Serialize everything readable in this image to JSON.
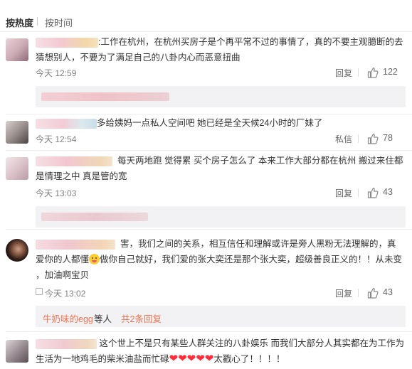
{
  "sort": {
    "hot_label": "按热度",
    "time_label": "按时间"
  },
  "colors": {
    "accent": "#eb7350",
    "heart": "#ff2d3a"
  },
  "comments": [
    {
      "text_line1": "工作在杭州，在杭州买房子是个再平常不过的事情了，真的不要主观臆断的去",
      "text_line2": "猜想别人，不要为了满足自己的八卦内心而恶意扭曲",
      "time": "今天 12:59",
      "reply_label": "回复",
      "likes": "122"
    },
    {
      "text_line1": "多给姨妈一点私人空间吧 她已经是全天候24小时的厂妹了",
      "time": "今天 12:54",
      "reply_label": "私信",
      "likes": "78"
    },
    {
      "text_line1": "每天两地跑 觉得累 买个房子怎么了 本来工作大部分都在杭州 搬过来住都",
      "text_line2": "是情理之中 真是管的宽",
      "time": "今天 13:03",
      "reply_label": "回复",
      "likes": "43"
    },
    {
      "text_line1": "害，我们之间的关系，相互信任和理解或许是旁人黑粉无法理解的，真",
      "text_line2a": "爱你的人都懂",
      "text_line2b": "做你自己就好，我们爱的张大奕还是那个张大奕，超级善良正义的！！从未变",
      "text_line3": "，加油啊宝贝",
      "time": "今天 13:02",
      "reply_label": "回复",
      "likes": "43",
      "emoji": "smile-emoji"
    },
    {
      "text_line1": "这个世上不是只有某些人群关注的八卦娱乐 而我们大部分人其实都在为工作为",
      "text_line2": "生活为一地鸡毛的柴米油盐而忙碌",
      "hearts": "❤❤❤❤❤",
      "text_tail": "太戳心了！！！！"
    }
  ],
  "reply_summary": {
    "name": "牛奶味的egg",
    "middle": " 等人 ",
    "link": "共2条回复"
  }
}
